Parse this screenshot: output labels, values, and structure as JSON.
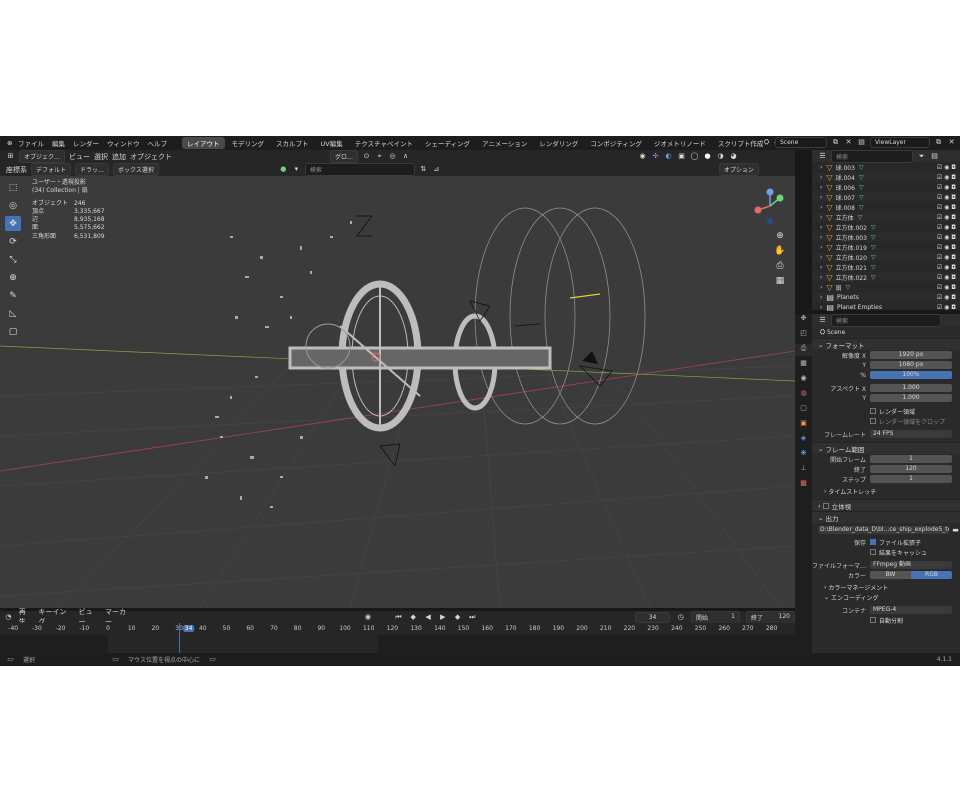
{
  "menu": {
    "items": [
      "ファイル",
      "編集",
      "レンダー",
      "ウィンドウ",
      "ヘルプ"
    ],
    "workspaces": [
      "レイアウト",
      "モデリング",
      "スカルプト",
      "UV編集",
      "テクスチャペイント",
      "シェーディング",
      "アニメーション",
      "レンダリング",
      "コンポジティング",
      "ジオメトリノード",
      "スクリプト作成"
    ],
    "plus": "+",
    "scene": "Scene",
    "view_layer": "ViewLayer"
  },
  "viewport_header": {
    "mode": "オブジェク…",
    "view": "ビュー",
    "select": "選択",
    "add": "追加",
    "object": "オブジェクト",
    "transform": "グロ…",
    "coord_label": "座標系",
    "coord": "デフォルト",
    "drag": "ドラッ…",
    "box_select": "ボックス選択",
    "search_placeholder": "検索",
    "options": "オプション"
  },
  "stats": {
    "title": "ユーザー・透視投影",
    "collection": "(34) Collection | 扇",
    "rows": [
      {
        "label": "オブジェクト",
        "value": "246"
      },
      {
        "label": "頂点",
        "value": "3,335,667"
      },
      {
        "label": "辺",
        "value": "8,935,168"
      },
      {
        "label": "面",
        "value": "5,575,662"
      },
      {
        "label": "三角形面",
        "value": "6,531,809"
      }
    ]
  },
  "timeline": {
    "playback": "再生",
    "keying": "キーイング",
    "view": "ビュー",
    "marker": "マーカー",
    "current_frame": "34",
    "start_label": "開始",
    "start": "1",
    "end_label": "終了",
    "end": "120",
    "ruler": [
      "-40",
      "-30",
      "-20",
      "-10",
      "0",
      "10",
      "20",
      "30",
      "34",
      "40",
      "50",
      "60",
      "70",
      "80",
      "90",
      "100",
      "110",
      "120",
      "130",
      "140",
      "150",
      "160",
      "170",
      "180",
      "190",
      "200",
      "210",
      "220",
      "230",
      "240",
      "250",
      "260",
      "270",
      "280"
    ]
  },
  "statusbar": {
    "select": "選択",
    "center_view": "マウス位置を視点の中心に",
    "version": "4.1.1"
  },
  "outliner": {
    "search_placeholder": "検索",
    "rows": [
      "球.003",
      "球.004",
      "球.006",
      "球.007",
      "球.008",
      "立方体",
      "立方体.002",
      "立方体.003",
      "立方体.019",
      "立方体.020",
      "立方体.021",
      "立方体.022",
      "扇",
      "Planets",
      "Planet Empties"
    ]
  },
  "properties": {
    "search_placeholder": "検索",
    "scene": "Scene",
    "format": {
      "title": "フォーマット",
      "res_label": "解像度 X",
      "res_x": "1920 px",
      "y_label": "Y",
      "res_y": "1080 px",
      "pct_label": "%",
      "pct": "100%",
      "aspect_label": "アスペクト X",
      "aspect_x": "1.000",
      "aspect_y": "1.000",
      "render_region": "レンダー領域",
      "crop": "レンダー領域をクロップ",
      "fps_label": "フレームレート",
      "fps": "24 FPS"
    },
    "frame_range": {
      "title": "フレーム範囲",
      "start_label": "開始フレーム",
      "start": "1",
      "end_label": "終了",
      "end": "120",
      "step_label": "ステップ",
      "step": "1"
    },
    "time_stretch": "タイムストレッチ",
    "stereo": "立体視",
    "output": {
      "title": "出力",
      "path": "D:\\Blender_data_D\\bl...ce_ship_explode5_test",
      "save_label": "保存",
      "file_ext": "ファイル拡張子",
      "cache": "結果をキャッシュ",
      "format_label": "ファイルフォーマ…",
      "format": "FFmpeg 動画",
      "color_label": "カラー",
      "bw": "BW",
      "rgb": "RGB"
    },
    "color_management": "カラーマネージメント",
    "encoding": {
      "title": "エンコーディング",
      "container_label": "コンテナ",
      "container": "MPEG-4",
      "autosplit": "自動分割"
    }
  },
  "colors": {
    "accent": "#4772b3",
    "object_orange": "#f49a3d",
    "data_green": "#6dd47e"
  }
}
